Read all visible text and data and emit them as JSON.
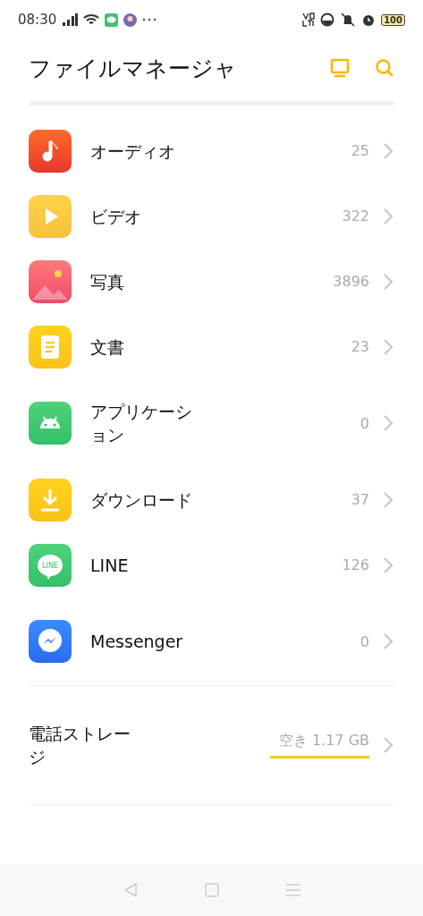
{
  "status_bar": {
    "time": "08:30",
    "battery": "100"
  },
  "header": {
    "title": "ファイルマネージャ"
  },
  "categories": [
    {
      "kind": "audio",
      "label": "オーディオ",
      "count": "25"
    },
    {
      "kind": "video",
      "label": "ビデオ",
      "count": "322"
    },
    {
      "kind": "photo",
      "label": "写真",
      "count": "3896"
    },
    {
      "kind": "document",
      "label": "文書",
      "count": "23"
    },
    {
      "kind": "app",
      "label": "アプリケーション",
      "count": "0"
    },
    {
      "kind": "download",
      "label": "ダウンロード",
      "count": "37"
    },
    {
      "kind": "line",
      "label": "LINE",
      "count": "126",
      "icon_text": "LINE"
    },
    {
      "kind": "messenger",
      "label": "Messenger",
      "count": "0"
    }
  ],
  "storage": {
    "label": "電話ストレージ",
    "free": "空き 1.17 GB"
  }
}
